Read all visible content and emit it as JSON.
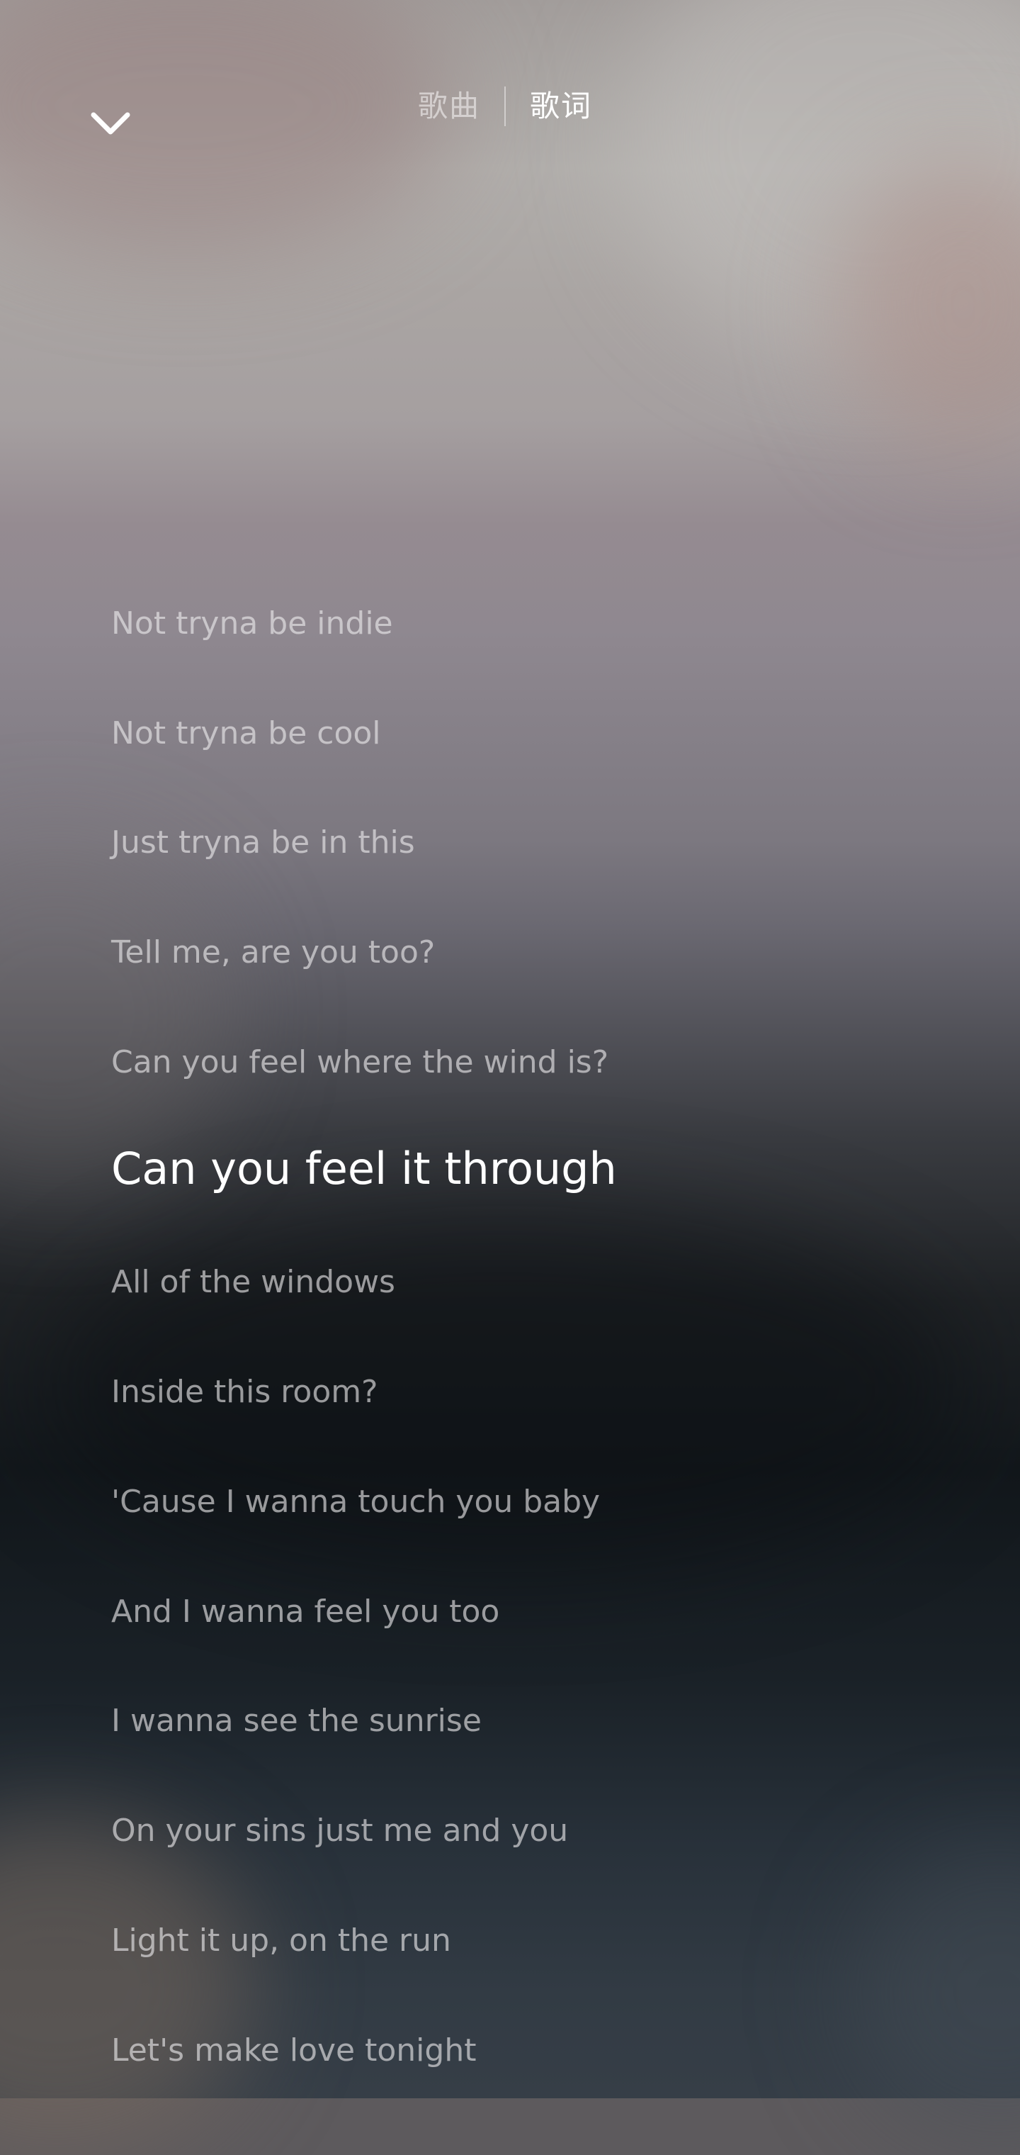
{
  "header": {
    "tabs": [
      {
        "label": "歌曲",
        "active": false
      },
      {
        "label": "歌词",
        "active": true
      }
    ],
    "back_icon": "chevron-down-icon"
  },
  "lyrics": {
    "current_index": 5,
    "lines": [
      "Not tryna be indie",
      "Not tryna be cool",
      "Just tryna be in this",
      "Tell me, are you too?",
      "Can you feel where the wind is?",
      "Can you feel it through",
      "All of the windows",
      "Inside this room?",
      "'Cause I wanna touch you baby",
      "And I wanna feel you too",
      "I wanna see the sunrise",
      "On your sins just me and you",
      "Light it up, on the run",
      "Let's make love tonight"
    ]
  },
  "colors": {
    "active_text": "#ffffff",
    "inactive_text": "#eeecee"
  }
}
